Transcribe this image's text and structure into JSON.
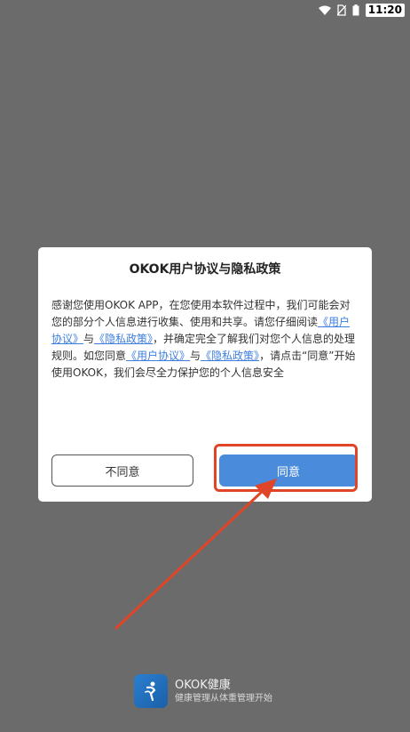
{
  "status_bar": {
    "time": "11:20",
    "icons": [
      "wifi-icon",
      "no-sim-icon",
      "battery-icon"
    ]
  },
  "dialog": {
    "title": "OKOK用户协议与隐私政策",
    "body": {
      "p1": "感谢您使用OKOK APP，在您使用本软件过程中，我们可能会对您的部分个人信息进行收集、使用和共享。请您仔细阅读",
      "link_user_agreement": "《用户协议》",
      "and1": "与",
      "link_privacy_policy": "《隐私政策》",
      "p2": "，并确定完全了解我们对您个人信息的处理规则。如您同意",
      "link_user_agreement_2": "《用户协议》",
      "and2": "与",
      "link_privacy_policy_2": "《隐私政策》",
      "p3": "，请点击“同意”开始使用OKOK，我们会尽全力保护您的个人信息安全"
    },
    "disagree_label": "不同意",
    "agree_label": "同意"
  },
  "brand": {
    "name": "OKOK健康",
    "slogan": "健康管理从体重管理开始"
  },
  "colors": {
    "overlay": "#6b6b6b",
    "accent": "#4a8bdc",
    "link": "#3d7ee0",
    "annotation": "#e04527"
  }
}
